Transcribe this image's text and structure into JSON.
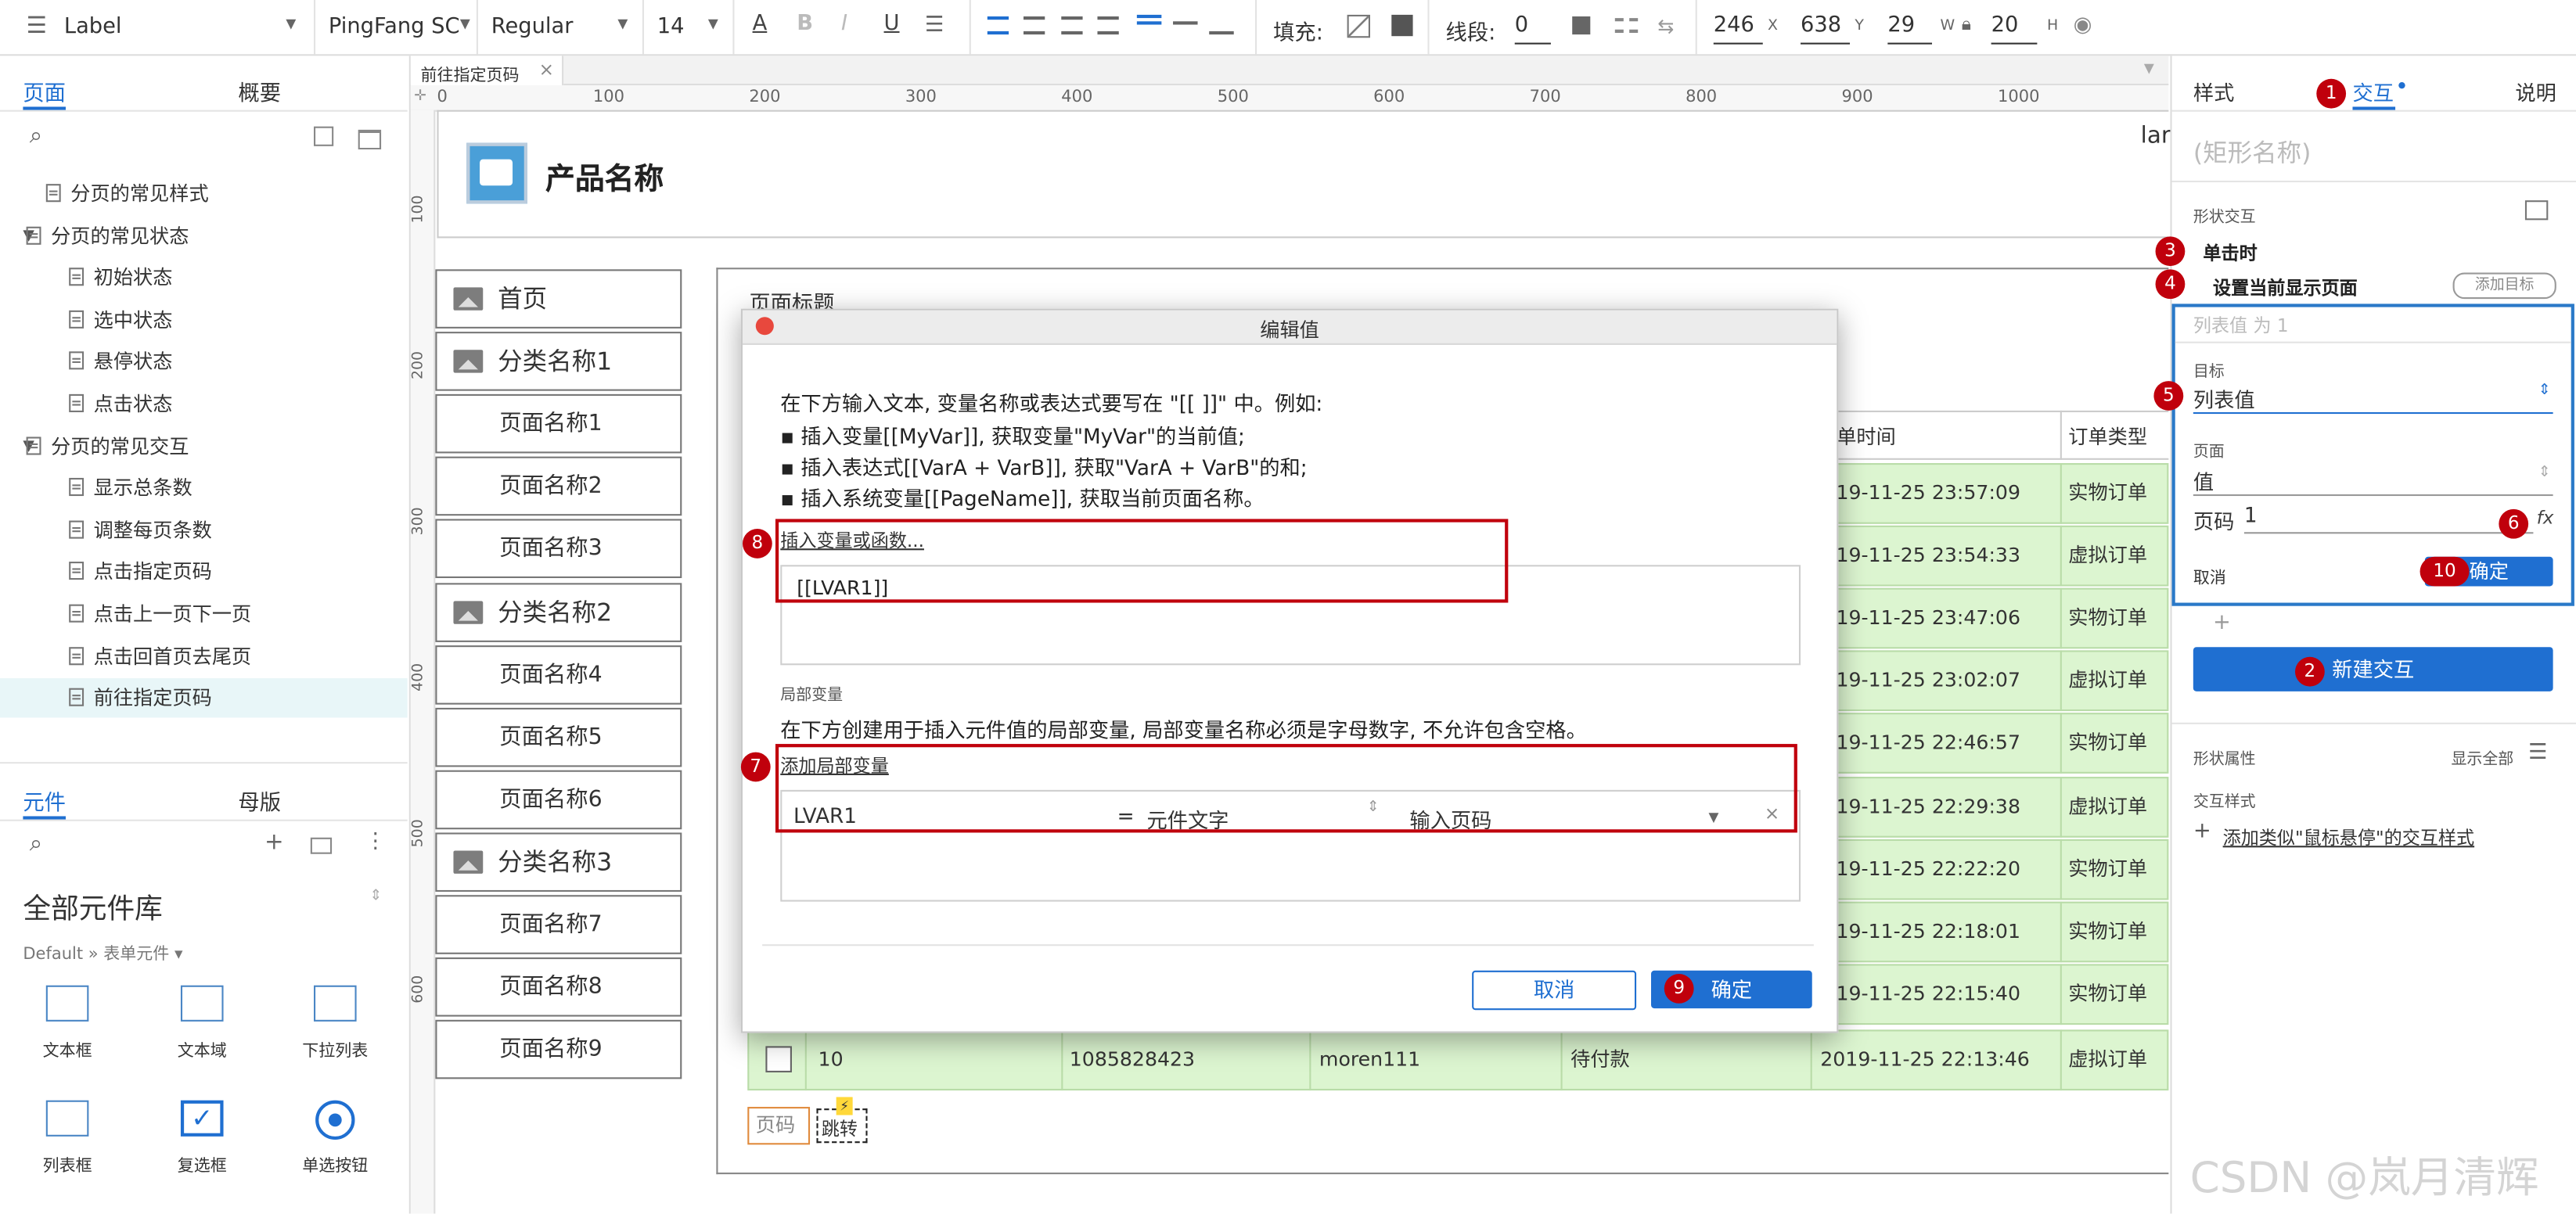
{
  "toolbar": {
    "style_name": "Label",
    "font_family": "PingFang SC",
    "font_weight": "Regular",
    "font_size": "14",
    "fill_label": "填充:",
    "line_label": "线段:",
    "line_value": "0",
    "x": "246",
    "x_label": "X",
    "y": "638",
    "y_label": "Y",
    "w": "29",
    "w_label": "W",
    "h": "20",
    "h_label": "H"
  },
  "left": {
    "tab_pages": "页面",
    "tab_outline": "概要",
    "tree": [
      {
        "label": "分页的常见样式",
        "level": 1,
        "caret": ""
      },
      {
        "label": "分页的常见状态",
        "level": 0,
        "caret": "▼"
      },
      {
        "label": "初始状态",
        "level": 2,
        "caret": ""
      },
      {
        "label": "选中状态",
        "level": 2,
        "caret": ""
      },
      {
        "label": "悬停状态",
        "level": 2,
        "caret": ""
      },
      {
        "label": "点击状态",
        "level": 2,
        "caret": ""
      },
      {
        "label": "分页的常见交互",
        "level": 0,
        "caret": "▼"
      },
      {
        "label": "显示总条数",
        "level": 2,
        "caret": ""
      },
      {
        "label": "调整每页条数",
        "level": 2,
        "caret": ""
      },
      {
        "label": "点击指定页码",
        "level": 2,
        "caret": ""
      },
      {
        "label": "点击上一页下一页",
        "level": 2,
        "caret": ""
      },
      {
        "label": "点击回首页去尾页",
        "level": 2,
        "caret": ""
      },
      {
        "label": "前往指定页码",
        "level": 2,
        "caret": "",
        "selected": true
      }
    ],
    "tab_widgets": "元件",
    "tab_masters": "母版",
    "library": "全部元件库",
    "breadcrumb": "Default » 表单元件",
    "widgets": [
      "文本框",
      "文本域",
      "下拉列表",
      "列表框",
      "复选框",
      "单选按钮"
    ],
    "widget_icons": [
      "text-field-icon",
      "text-area-icon",
      "dropdown-list-icon",
      "list-box-icon",
      "checkbox-icon",
      "radio-button-icon"
    ]
  },
  "canvas": {
    "tab": "前往指定页码",
    "ruler_h": [
      "0",
      "100",
      "200",
      "300",
      "400",
      "500",
      "600",
      "700",
      "800",
      "900",
      "1000"
    ],
    "ruler_v": [
      "100",
      "200",
      "300",
      "400",
      "500",
      "600"
    ],
    "product_name": "产品名称",
    "corner_text": "lar",
    "nav": [
      {
        "label": "首页",
        "icon": true
      },
      {
        "label": "分类名称1",
        "icon": true
      },
      {
        "label": "页面名称1",
        "icon": false
      },
      {
        "label": "页面名称2",
        "icon": false
      },
      {
        "label": "页面名称3",
        "icon": false
      },
      {
        "label": "分类名称2",
        "icon": true
      },
      {
        "label": "页面名称4",
        "icon": false
      },
      {
        "label": "页面名称5",
        "icon": false
      },
      {
        "label": "页面名称6",
        "icon": false
      },
      {
        "label": "分类名称3",
        "icon": true
      },
      {
        "label": "页面名称7",
        "icon": false
      },
      {
        "label": "页面名称8",
        "icon": false
      },
      {
        "label": "页面名称9",
        "icon": false
      }
    ],
    "page_title": "页面标题",
    "col_time": "单时间",
    "col_type": "订单类型",
    "rows": [
      {
        "time": "019-11-25 23:57:09",
        "type": "实物订单"
      },
      {
        "time": "019-11-25 23:54:33",
        "type": "虚拟订单"
      },
      {
        "time": "019-11-25 23:47:06",
        "type": "实物订单"
      },
      {
        "time": "019-11-25 23:02:07",
        "type": "虚拟订单"
      },
      {
        "time": "019-11-25 22:46:57",
        "type": "实物订单"
      },
      {
        "time": "019-11-25 22:29:38",
        "type": "虚拟订单"
      },
      {
        "time": "019-11-25 22:22:20",
        "type": "实物订单"
      },
      {
        "time": "019-11-25 22:18:01",
        "type": "实物订单"
      },
      {
        "time": "019-11-25 22:15:40",
        "type": "实物订单"
      }
    ],
    "last_row": {
      "no": "10",
      "id": "1085828423",
      "user": "moren111",
      "status": "待付款",
      "time": "2019-11-25 22:13:46",
      "type": "虚拟订单"
    },
    "page_input": "页码",
    "jump_label": "跳转"
  },
  "dialog": {
    "title": "编辑值",
    "intro": "在下方输入文本, 变量名称或表达式要写在 \"[[ ]]\" 中。例如:",
    "bullets": [
      "▪ 插入变量[[MyVar]], 获取变量\"MyVar\"的当前值;",
      "▪ 插入表达式[[VarA + VarB]], 获取\"VarA + VarB\"的和;",
      "▪ 插入系统变量[[PageName]], 获取当前页面名称。"
    ],
    "insert_link": "插入变量或函数...",
    "expr_value": "[[LVAR1]]",
    "local_title": "局部变量",
    "local_desc": "在下方创建用于插入元件值的局部变量, 局部变量名称必须是字母数字, 不允许包含空格。",
    "add_local": "添加局部变量",
    "var_name": "LVAR1",
    "var_eq": "=",
    "var_type": "元件文字",
    "var_target": "输入页码",
    "cancel": "取消",
    "ok": "确定"
  },
  "right": {
    "tab_style": "样式",
    "tab_interact": "交互",
    "tab_notes": "说明",
    "shape_name_placeholder": "(矩形名称)",
    "shape_interactions": "形状交互",
    "on_click": "单击时",
    "action": "设置当前显示页面",
    "add_target": "添加目标",
    "summary": "列表值 为 1",
    "target_label": "目标",
    "target_value": "列表值",
    "page_label": "页面",
    "page_value": "值",
    "page_no_label": "页码",
    "page_no_value": "1",
    "fx": "fx",
    "cancel": "取消",
    "ok": "确定",
    "plus": "+",
    "new_interaction": "新建交互",
    "shape_props": "形状属性",
    "show_all": "显示全部",
    "interact_style": "交互样式",
    "add_hover": "添加类似\"鼠标悬停\"的交互样式"
  },
  "badges": [
    "1",
    "2",
    "3",
    "4",
    "5",
    "6",
    "7",
    "8",
    "9",
    "10"
  ],
  "watermark": "CSDN @岚月清辉",
  "colors": {
    "accent": "#1f6fd1",
    "annotation_red": "#c0000c",
    "row_green": "#dcf5d0",
    "selected_row": "#e8f6f8"
  }
}
